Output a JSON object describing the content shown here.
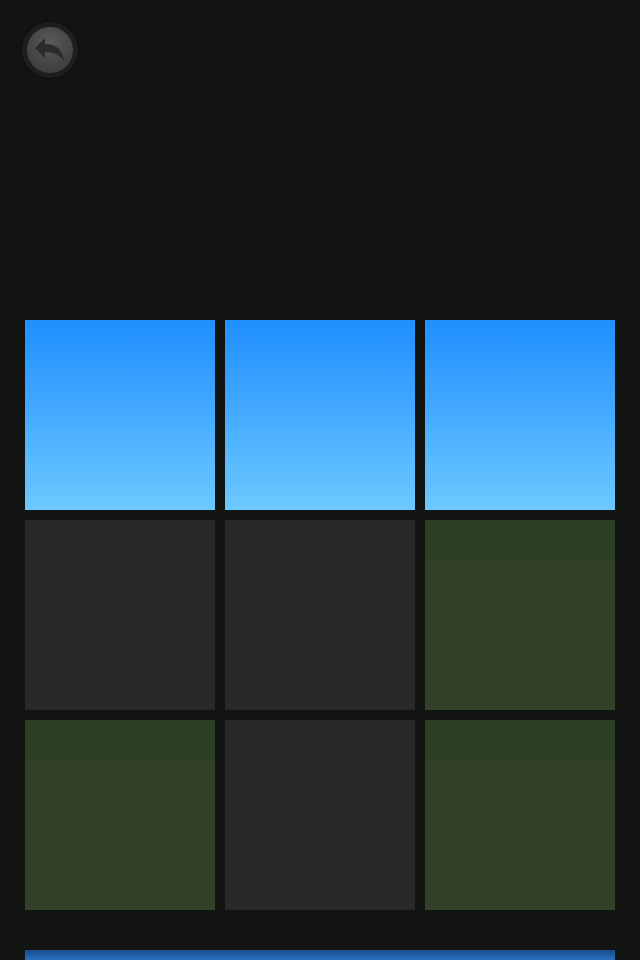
{
  "header": {
    "back_button": {
      "icon": "back-arrow-icon"
    }
  },
  "board": {
    "rows": 3,
    "cols": 3,
    "tiles": [
      {
        "kind": "sky"
      },
      {
        "kind": "sky"
      },
      {
        "kind": "sky"
      },
      {
        "kind": "empty"
      },
      {
        "kind": "empty"
      },
      {
        "kind": "grass"
      },
      {
        "kind": "grass"
      },
      {
        "kind": "empty"
      },
      {
        "kind": "grass"
      }
    ]
  },
  "colors": {
    "background": "#121412",
    "sky_top": "#2090ff",
    "sky_bottom": "#6ccaff",
    "empty_tile": "#292929",
    "grass_tile": "#334129",
    "grass_top": "#2b4022",
    "bottom_bar": "#2a6fc0"
  }
}
